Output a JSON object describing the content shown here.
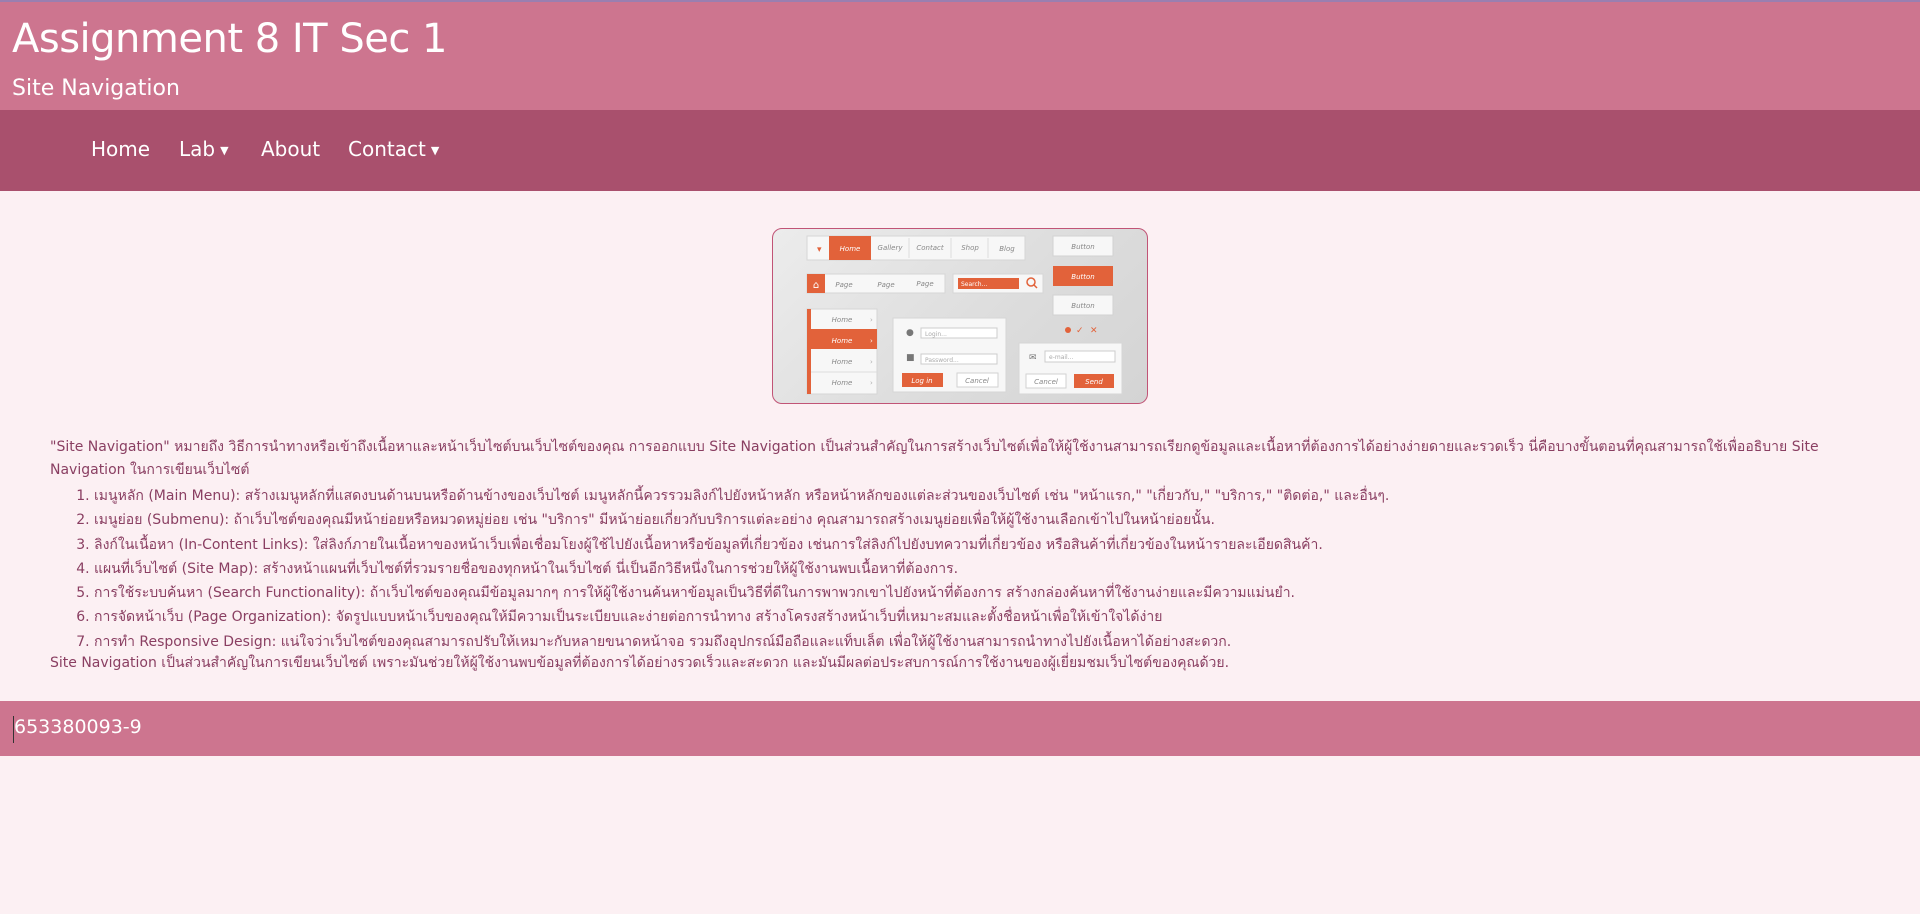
{
  "header": {
    "title": "Assignment 8 IT Sec 1",
    "subtitle": "Site Navigation"
  },
  "nav": {
    "items": [
      {
        "label": "Home",
        "has_dropdown": false
      },
      {
        "label": "Lab",
        "has_dropdown": true
      },
      {
        "label": "About",
        "has_dropdown": false
      },
      {
        "label": "Contact",
        "has_dropdown": true
      }
    ]
  },
  "hero": {
    "tabs": [
      "Home",
      "Gallery",
      "Contact",
      "Shop",
      "Blog"
    ],
    "breadcrumbs": [
      "Page",
      "Page",
      "Page"
    ],
    "search_placeholder": "Search...",
    "buttons": [
      "Button",
      "Button",
      "Button"
    ],
    "side_menu": [
      "Home",
      "Home",
      "Home",
      "Home"
    ],
    "login_placeholder": "Login...",
    "password_placeholder": "Password...",
    "login_button": "Log in",
    "cancel_button": "Cancel",
    "email_placeholder": "e-mail...",
    "cancel2_button": "Cancel",
    "send_button": "Send",
    "colors": {
      "accent": "#e2623a",
      "panel": "#f7f7f7"
    }
  },
  "content": {
    "intro": "\"Site Navigation\" หมายถึง วิธีการนำทางหรือเข้าถึงเนื้อหาและหน้าเว็บไซต์บนเว็บไซต์ของคุณ การออกแบบ Site Navigation เป็นส่วนสำคัญในการสร้างเว็บไซต์เพื่อให้ผู้ใช้งานสามารถเรียกดูข้อมูลและเนื้อหาที่ต้องการได้อย่างง่ายดายและรวดเร็ว นี่คือบางขั้นตอนที่คุณสามารถใช้เพื่ออธิบาย Site Navigation ในการเขียนเว็บไซต์",
    "steps": [
      "เมนูหลัก (Main Menu): สร้างเมนูหลักที่แสดงบนด้านบนหรือด้านข้างของเว็บไซต์ เมนูหลักนี้ควรรวมลิงก์ไปยังหน้าหลัก หรือหน้าหลักของแต่ละส่วนของเว็บไซต์ เช่น \"หน้าแรก,\" \"เกี่ยวกับ,\" \"บริการ,\" \"ติดต่อ,\" และอื่นๆ.",
      "เมนูย่อย (Submenu): ถ้าเว็บไซต์ของคุณมีหน้าย่อยหรือหมวดหมู่ย่อย เช่น \"บริการ\" มีหน้าย่อยเกี่ยวกับบริการแต่ละอย่าง คุณสามารถสร้างเมนูย่อยเพื่อให้ผู้ใช้งานเลือกเข้าไปในหน้าย่อยนั้น.",
      "ลิงก์ในเนื้อหา (In-Content Links): ใส่ลิงก์ภายในเนื้อหาของหน้าเว็บเพื่อเชื่อมโยงผู้ใช้ไปยังเนื้อหาหรือข้อมูลที่เกี่ยวข้อง เช่นการใส่ลิงก์ไปยังบทความที่เกี่ยวข้อง หรือสินค้าที่เกี่ยวข้องในหน้ารายละเอียดสินค้า.",
      "แผนที่เว็บไซต์ (Site Map): สร้างหน้าแผนที่เว็บไซต์ที่รวมรายชื่อของทุกหน้าในเว็บไซต์ นี่เป็นอีกวิธีหนึ่งในการช่วยให้ผู้ใช้งานพบเนื้อหาที่ต้องการ.",
      "การใช้ระบบค้นหา (Search Functionality): ถ้าเว็บไซต์ของคุณมีข้อมูลมากๆ การให้ผู้ใช้งานค้นหาข้อมูลเป็นวิธีที่ดีในการพาพวกเขาไปยังหน้าที่ต้องการ สร้างกล่องค้นหาที่ใช้งานง่ายและมีความแม่นยำ.",
      "การจัดหน้าเว็บ (Page Organization): จัดรูปแบบหน้าเว็บของคุณให้มีความเป็นระเบียบและง่ายต่อการนำทาง สร้างโครงสร้างหน้าเว็บที่เหมาะสมและตั้งชื่อหน้าเพื่อให้เข้าใจได้ง่าย",
      "การทำ Responsive Design: แน่ใจว่าเว็บไซต์ของคุณสามารถปรับให้เหมาะกับหลายขนาดหน้าจอ รวมถึงอุปกรณ์มือถือและแท็บเล็ต เพื่อให้ผู้ใช้งานสามารถนำทางไปยังเนื้อหาได้อย่างสะดวก."
    ],
    "outro": "Site Navigation เป็นส่วนสำคัญในการเขียนเว็บไซต์ เพราะมันช่วยให้ผู้ใช้งานพบข้อมูลที่ต้องการได้อย่างรวดเร็วและสะดวก และมันมีผลต่อประสบการณ์การใช้งานของผู้เยี่ยมชมเว็บไซต์ของคุณด้วย."
  },
  "footer": {
    "text": "653380093-9"
  },
  "colors": {
    "header_bg": "#cd758f",
    "nav_bg": "#a9506d",
    "page_bg": "#fcf0f3",
    "body_text": "#8a3f62"
  }
}
